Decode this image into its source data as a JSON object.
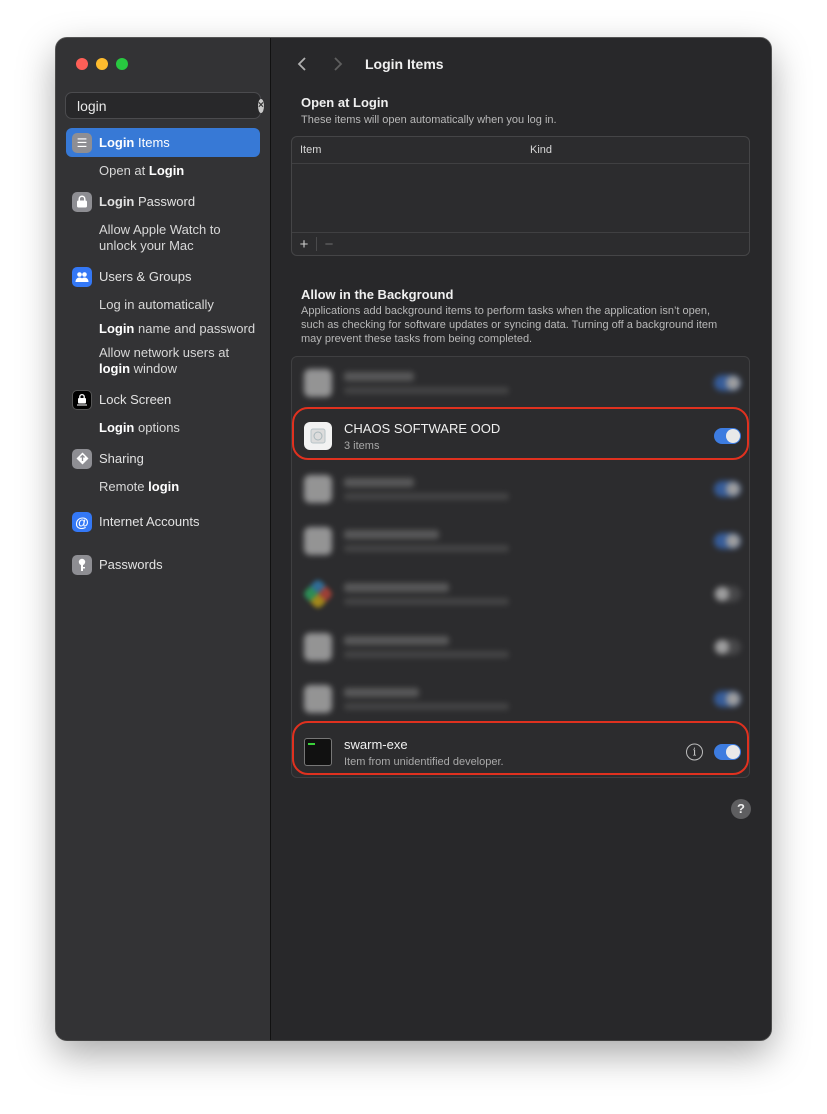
{
  "window": {
    "traffic_lights": [
      "close",
      "minimize",
      "zoom"
    ]
  },
  "sidebar": {
    "search": {
      "value": "login",
      "placeholder": "Search"
    },
    "groups": [
      {
        "label": "Login Items",
        "icon": "list-icon",
        "color": "#8e8e93",
        "active": true,
        "subs": [
          "Open at Login"
        ]
      },
      {
        "label": "Login Password",
        "icon": "lock-icon",
        "color": "#8e8e93",
        "active": false,
        "subs": [
          "Allow Apple Watch to unlock your Mac"
        ]
      },
      {
        "label": "Users & Groups",
        "icon": "users-icon",
        "color": "#3478f6",
        "active": false,
        "subs": [
          "Log in automatically",
          "Login name and password",
          "Allow network users at login window"
        ]
      },
      {
        "label": "Lock Screen",
        "icon": "lock-screen-icon",
        "color": "#000000",
        "active": false,
        "subs": [
          "Login options"
        ]
      },
      {
        "label": "Sharing",
        "icon": "sharing-icon",
        "color": "#8e8e93",
        "active": false,
        "subs": [
          "Remote login"
        ]
      },
      {
        "label": "Internet Accounts",
        "icon": "at-icon",
        "color": "#3478f6",
        "active": false,
        "subs": []
      },
      {
        "label": "Passwords",
        "icon": "key-icon",
        "color": "#8e8e93",
        "active": false,
        "subs": []
      }
    ]
  },
  "toolbar": {
    "back": "‹",
    "forward": "›",
    "title": "Login Items"
  },
  "open_at_login": {
    "title": "Open at Login",
    "description": "These items will open automatically when you log in.",
    "columns": [
      "Item",
      "Kind"
    ],
    "add": "+",
    "remove": "−"
  },
  "background": {
    "title": "Allow in the Background",
    "description": "Applications add background items to perform tasks when the application isn’t open, such as checking for software updates or syncing data. Turning off a background item may prevent these tasks from being completed.",
    "items": [
      {
        "name": "",
        "sub": "",
        "enabled": true,
        "blurred": true
      },
      {
        "name": "CHAOS SOFTWARE OOD",
        "sub": "3 items",
        "enabled": true,
        "blurred": false
      },
      {
        "name": "",
        "sub": "",
        "enabled": true,
        "blurred": true
      },
      {
        "name": "",
        "sub": "",
        "enabled": true,
        "blurred": true
      },
      {
        "name": "",
        "sub": "",
        "enabled": false,
        "blurred": true
      },
      {
        "name": "",
        "sub": "",
        "enabled": false,
        "blurred": true
      },
      {
        "name": "",
        "sub": "",
        "enabled": true,
        "blurred": true
      },
      {
        "name": "swarm-exe",
        "sub": "Item from unidentified developer.",
        "enabled": true,
        "blurred": false,
        "info": "i"
      }
    ]
  },
  "help": "?",
  "colors": {
    "accent": "#3779d6",
    "highlight": "#e0311f"
  }
}
